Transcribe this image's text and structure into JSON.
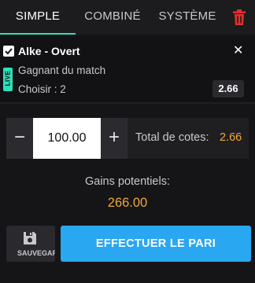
{
  "tabs": [
    {
      "label": "SIMPLE",
      "active": true
    },
    {
      "label": "COMBINÉ",
      "active": false
    },
    {
      "label": "SYSTÈME",
      "active": false
    }
  ],
  "bet": {
    "event": "Alke - Overt",
    "market": "Gagnant du match",
    "selection": "Choisir : 2",
    "odds": "2.66",
    "live_label": "LIVE",
    "checked": true
  },
  "stake": {
    "value": "100.00",
    "minus_label": "−",
    "plus_label": "+"
  },
  "total_odds": {
    "label": "Total de cotes:",
    "value": "2.66"
  },
  "gains": {
    "label": "Gains potentiels:",
    "value": "266.00"
  },
  "actions": {
    "save_label": "SAUVEGARDER",
    "place_label": "EFFECTUER LE PARI"
  },
  "colors": {
    "accent": "#2ee0b8",
    "highlight": "#f3a833",
    "primary_button": "#29a7f0",
    "danger": "#e0302c"
  },
  "icons": [
    "trash-icon",
    "checkbox-icon",
    "close-icon",
    "save-icon"
  ]
}
